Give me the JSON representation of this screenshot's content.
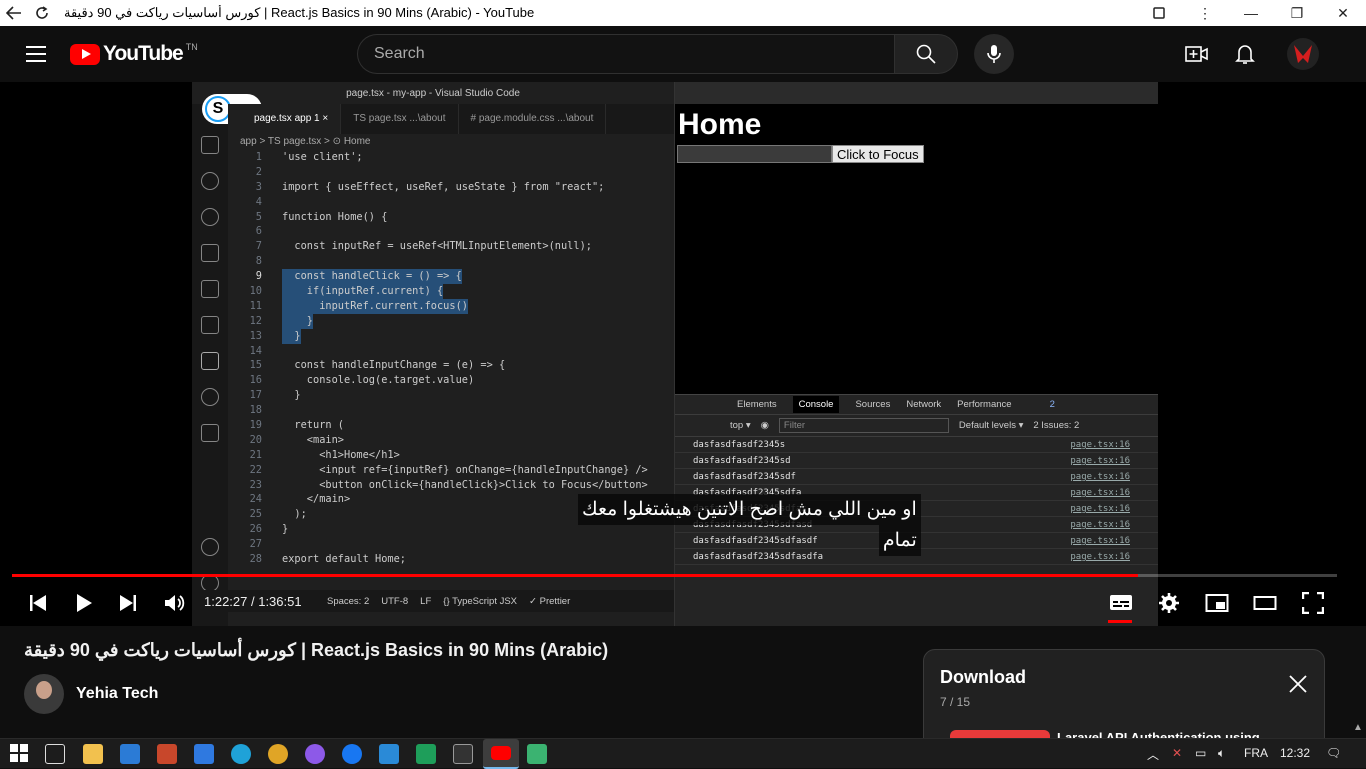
{
  "window": {
    "title": "كورس أساسيات رياكت في 90 دقيقة | React.js Basics in 90 Mins (Arabic) - YouTube"
  },
  "header": {
    "logo_text": "YouTube",
    "logo_badge": "TN",
    "search_placeholder": "Search"
  },
  "video": {
    "vscode": {
      "title": "page.tsx - my-app - Visual Studio Code",
      "tabs": [
        {
          "label": "page.tsx app 1 ×"
        },
        {
          "label": "TS page.tsx ...\\about"
        },
        {
          "label": "# page.module.css ...\\about"
        }
      ],
      "breadcrumb": "app > TS page.tsx > ⊙ Home",
      "code_lines": [
        {
          "n": "1",
          "text": "'use client';"
        },
        {
          "n": "2",
          "text": ""
        },
        {
          "n": "3",
          "text": "import { useEffect, useRef, useState } from \"react\";"
        },
        {
          "n": "4",
          "text": ""
        },
        {
          "n": "5",
          "text": "function Home() {"
        },
        {
          "n": "6",
          "text": ""
        },
        {
          "n": "7",
          "text": "  const inputRef = useRef<HTMLInputElement>(null);"
        },
        {
          "n": "8",
          "text": ""
        },
        {
          "n": "9",
          "text": "  const handleClick = () => {"
        },
        {
          "n": "10",
          "text": "    if(inputRef.current) {"
        },
        {
          "n": "11",
          "text": "      inputRef.current.focus()"
        },
        {
          "n": "12",
          "text": "    }"
        },
        {
          "n": "13",
          "text": "  }"
        },
        {
          "n": "14",
          "text": ""
        },
        {
          "n": "15",
          "text": "  const handleInputChange = (e) => {"
        },
        {
          "n": "16",
          "text": "    console.log(e.target.value)"
        },
        {
          "n": "17",
          "text": "  }"
        },
        {
          "n": "18",
          "text": ""
        },
        {
          "n": "19",
          "text": "  return ("
        },
        {
          "n": "20",
          "text": "    <main>"
        },
        {
          "n": "21",
          "text": "      <h1>Home</h1>"
        },
        {
          "n": "22",
          "text": "      <input ref={inputRef} onChange={handleInputChange} />"
        },
        {
          "n": "23",
          "text": "      <button onClick={handleClick}>Click to Focus</button>"
        },
        {
          "n": "24",
          "text": "    </main>"
        },
        {
          "n": "25",
          "text": "  );"
        },
        {
          "n": "26",
          "text": "}"
        },
        {
          "n": "27",
          "text": ""
        },
        {
          "n": "28",
          "text": "export default Home;"
        }
      ],
      "status": [
        "Spaces: 2",
        "UTF-8",
        "LF",
        "{} TypeScript JSX",
        "✓ Prettier"
      ]
    },
    "browser": {
      "heading": "Home",
      "button_label": "Click to Focus",
      "devtools_tabs": [
        "Elements",
        "Console",
        "Sources",
        "Network",
        "Performance"
      ],
      "devtools_context": "top ▾",
      "devtools_filter": "Filter",
      "devtools_levels": "Default levels ▾",
      "devtools_issues": "2 Issues: 2",
      "devtools_badge": "2",
      "logs": [
        {
          "text": "dasfasdfasdf2345s",
          "src": "page.tsx:16"
        },
        {
          "text": "dasfasdfasdf2345sd",
          "src": "page.tsx:16"
        },
        {
          "text": "dasfasdfasdf2345sdf",
          "src": "page.tsx:16"
        },
        {
          "text": "dasfasdfasdf2345sdfa",
          "src": "page.tsx:16"
        },
        {
          "text": "dasfasdfasdf2345sdfas",
          "src": "page.tsx:16"
        },
        {
          "text": "dasfasdfasdf2345sdfasd",
          "src": "page.tsx:16"
        },
        {
          "text": "dasfasdfasdf2345sdfasdf",
          "src": "page.tsx:16"
        },
        {
          "text": "dasfasdfasdf2345sdfasdfa",
          "src": "page.tsx:16"
        }
      ]
    },
    "subtitle_line1": "او مين اللي مش اصح الاتنين هيشتغلوا معك",
    "subtitle_line2": "تمام",
    "time": "1:22:27 / 1:36:51",
    "progress": 0.85
  },
  "info": {
    "title": "كورس أساسيات رياكت في 90 دقيقة | React.js Basics in 90 Mins (Arabic)",
    "channel": "Yehia Tech"
  },
  "download": {
    "title": "Download",
    "count": "7 / 15",
    "item_text": "Laravel API Authentication using"
  },
  "taskbar": {
    "lang": "FRA",
    "clock": "12:32"
  },
  "colors": {
    "youtube_red": "#ff0000",
    "selection": "#264f78"
  }
}
